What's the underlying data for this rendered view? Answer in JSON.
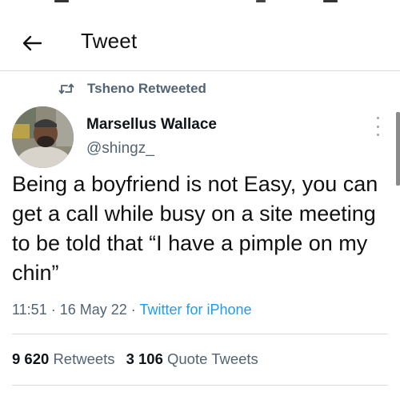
{
  "header": {
    "title": "Tweet",
    "back_icon": "arrow-left-icon"
  },
  "social_context": {
    "icon": "retweet-icon",
    "text": "Tsheno Retweeted"
  },
  "author": {
    "display_name": "Marsellus Wallace",
    "handle": "@shingz_",
    "avatar_icon": "avatar"
  },
  "tweet": {
    "text": "Being a boyfriend is not Easy, you can get a call while busy on  a site meeting to be told that “I have a pimple on my chin”",
    "time": "11:51",
    "separator": " · ",
    "date": "16 May 22",
    "source": "Twitter for iPhone"
  },
  "stats": {
    "retweets_count": "9 620",
    "retweets_label": "Retweets",
    "quote_tweets_count": "3 106",
    "quote_tweets_label": "Quote Tweets"
  },
  "colors": {
    "text_primary": "#0f1419",
    "text_secondary": "#536471",
    "link": "#1d9bf0",
    "divider": "#d9d9d9"
  }
}
